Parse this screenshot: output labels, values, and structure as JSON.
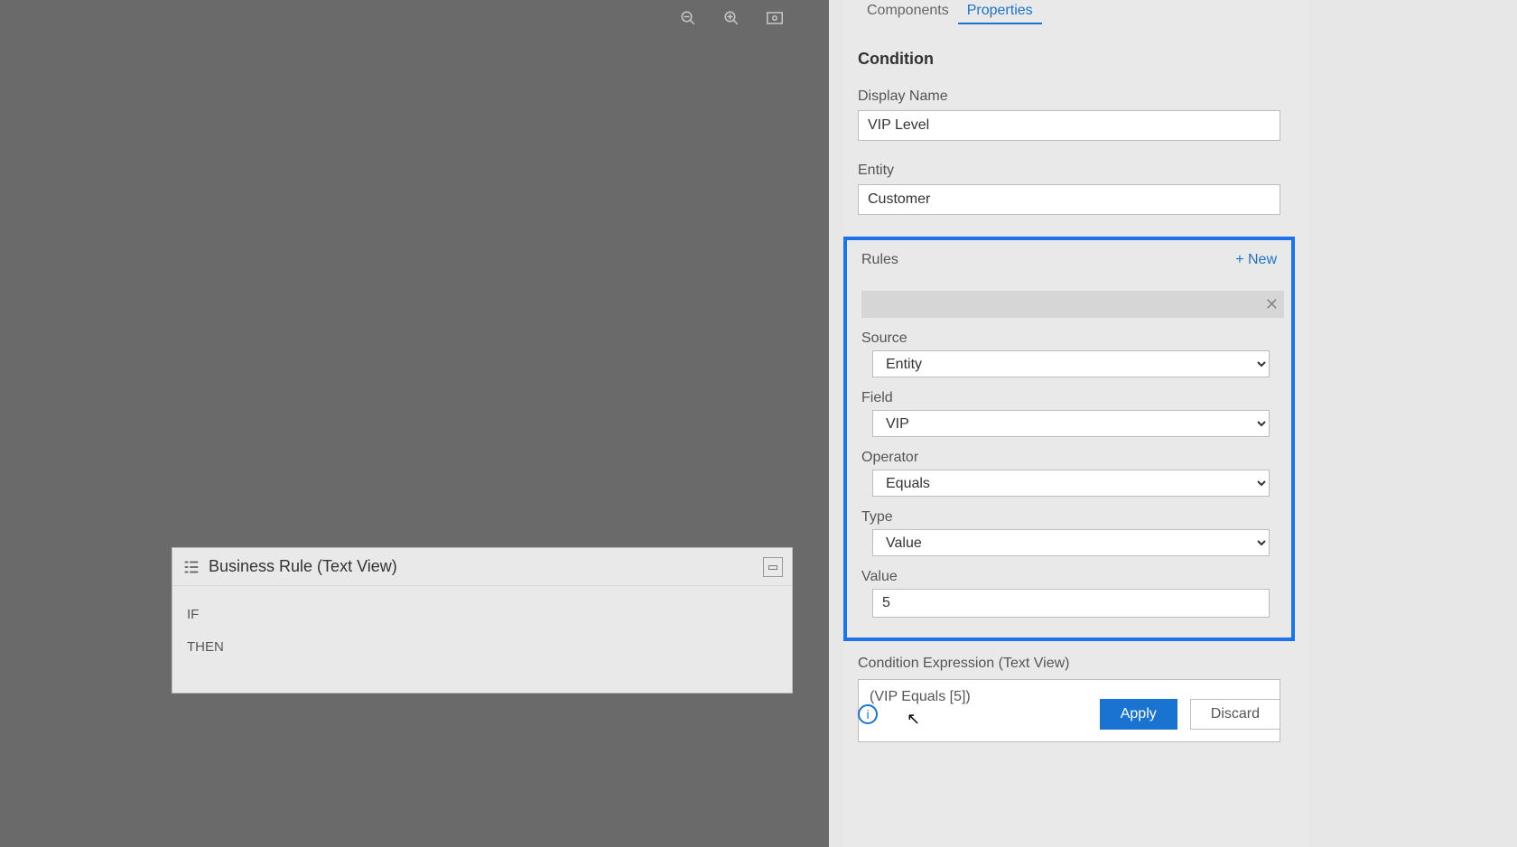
{
  "canvas": {
    "textView": {
      "title": "Business Rule (Text View)",
      "if": "IF",
      "then": "THEN"
    }
  },
  "tabs": {
    "components": "Components",
    "properties": "Properties"
  },
  "panel": {
    "section": "Condition",
    "displayNameLabel": "Display Name",
    "displayNameValue": "VIP Level",
    "entityLabel": "Entity",
    "entityValue": "Customer",
    "rules": {
      "title": "Rules",
      "newLabel": "+ New",
      "sourceLabel": "Source",
      "sourceValue": "Entity",
      "fieldLabel": "Field",
      "fieldValue": "VIP",
      "operatorLabel": "Operator",
      "operatorValue": "Equals",
      "typeLabel": "Type",
      "typeValue": "Value",
      "valueLabel": "Value",
      "valueValue": "5"
    },
    "expressionLabel": "Condition Expression (Text View)",
    "expressionValue": "(VIP Equals [5])",
    "applyLabel": "Apply",
    "discardLabel": "Discard"
  }
}
